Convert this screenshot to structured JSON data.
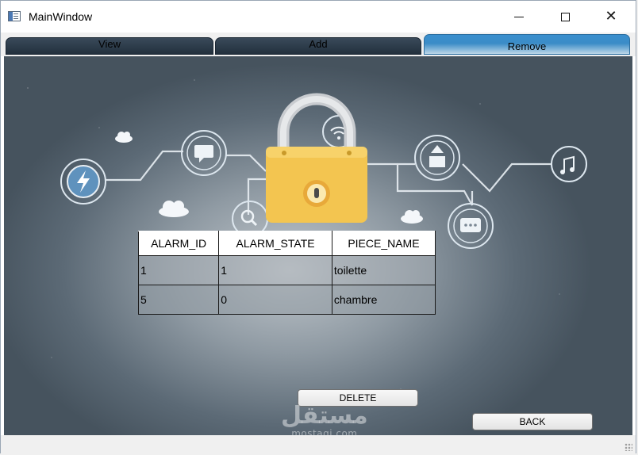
{
  "window": {
    "title": "MainWindow"
  },
  "tabs": [
    {
      "label": "View",
      "active": false
    },
    {
      "label": "Add",
      "active": false
    },
    {
      "label": "Remove",
      "active": true
    }
  ],
  "table": {
    "columns": [
      "ALARM_ID",
      "ALARM_STATE",
      "PIECE_NAME"
    ],
    "rows": [
      [
        "1",
        "1",
        "toilette"
      ],
      [
        "5",
        "0",
        "chambre"
      ]
    ]
  },
  "buttons": {
    "delete": "DELETE",
    "back": "BACK"
  },
  "watermark": {
    "arabic": "مستقل",
    "latin": "mostaqi.com"
  },
  "colors": {
    "active_tab": "#3a8fce",
    "background": "#5c6a76",
    "lock_body": "#f3c550"
  }
}
